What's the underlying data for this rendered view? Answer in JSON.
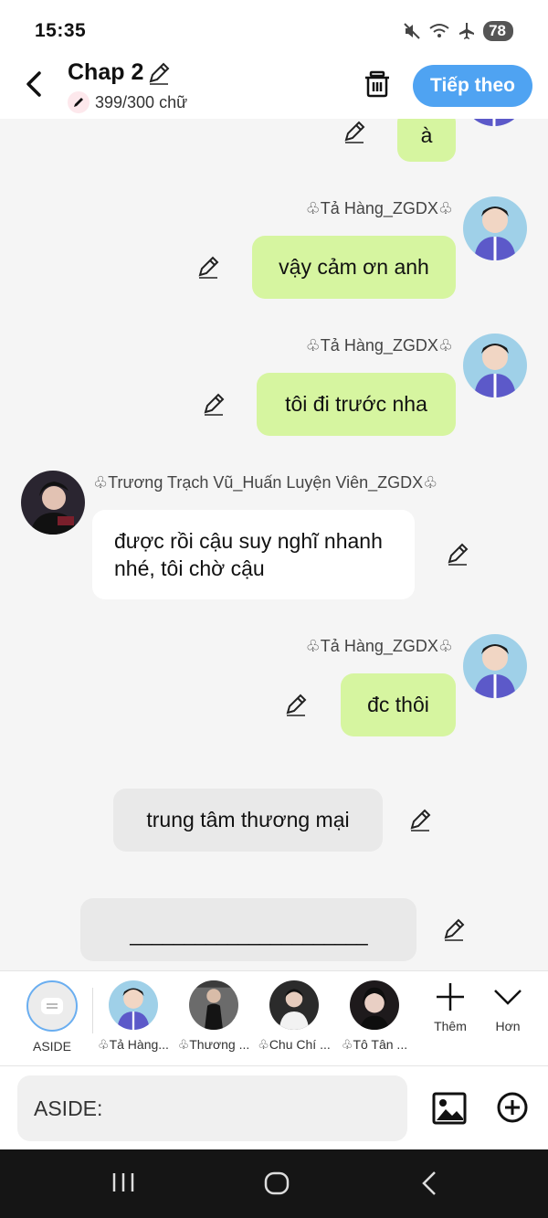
{
  "status_bar": {
    "time": "15:35",
    "battery": "78",
    "icons": [
      "mute-icon",
      "wifi-icon",
      "airplane-icon",
      "battery-icon"
    ]
  },
  "header": {
    "title": "Chap 2",
    "word_count": "399/300 chữ",
    "next_label": "Tiếp theo",
    "accent": "#4fa3f2"
  },
  "messages": [
    {
      "type": "right",
      "text": "à"
    },
    {
      "type": "right",
      "sender": "♧Tả Hàng_ZGDX♧",
      "text": "vậy cảm ơn anh"
    },
    {
      "type": "right",
      "sender": "♧Tả Hàng_ZGDX♧",
      "text": "tôi đi trước nha"
    },
    {
      "type": "left",
      "sender": "♧Trương Trạch Vũ_Huấn Luyện Viên_ZGDX♧",
      "text": "được rồi cậu suy nghĩ nhanh nhé, tôi chờ cậu"
    },
    {
      "type": "right",
      "sender": "♧Tả Hàng_ZGDX♧",
      "text": "đc thôi"
    },
    {
      "type": "aside",
      "text": "trung tâm thương mại"
    },
    {
      "type": "aside",
      "text": "______________________"
    }
  ],
  "colors": {
    "green_bubble": "#d6f5a0",
    "aside_bubble": "#e9e9e9",
    "white_bubble": "#ffffff"
  },
  "characters": [
    {
      "label": "ASIDE"
    },
    {
      "label": "♧Tả Hàng..."
    },
    {
      "label": "♧Thương ..."
    },
    {
      "label": "♧Chu Chí ..."
    },
    {
      "label": "♧Tô Tân ..."
    }
  ],
  "tools": {
    "more_label": "Thêm",
    "less_label": "Hơn"
  },
  "input": {
    "placeholder": "ASIDE:"
  }
}
